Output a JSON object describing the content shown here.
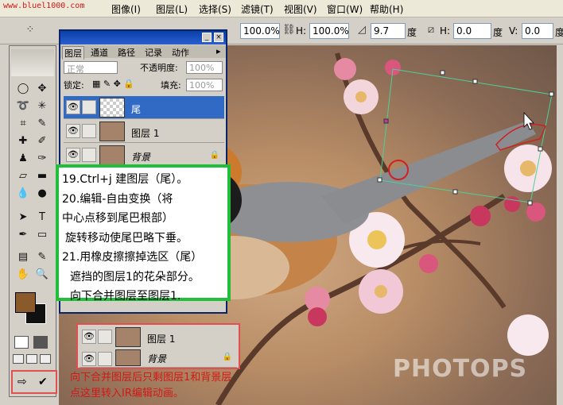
{
  "menubar": {
    "watermark": "www.bluel1000.com",
    "items": [
      "图像(I)",
      "图层(L)",
      "选择(S)",
      "滤镜(T)",
      "视图(V)",
      "窗口(W)",
      "帮助(H)"
    ]
  },
  "options": {
    "x_value": "100.0%",
    "h_label": "H:",
    "h_value": "100.0%",
    "angle_value": "9.7",
    "deg1": "度",
    "hskew_label": "H:",
    "hskew_value": "0.0",
    "deg2": "度",
    "vskew_label": "V:",
    "vskew_value": "0.0",
    "deg3": "度"
  },
  "layers_panel": {
    "tabs": [
      "图层",
      "通道",
      "路径",
      "记录",
      "动作"
    ],
    "blend_mode": "正常",
    "opacity_label": "不透明度:",
    "opacity_value": "100%",
    "lock_label": "锁定:",
    "fill_label": "填充:",
    "fill_value": "100%",
    "layers": [
      {
        "name": "尾",
        "selected": true
      },
      {
        "name": "图层 1",
        "selected": false
      },
      {
        "name": "背景",
        "selected": false
      }
    ]
  },
  "note": {
    "lines": [
      "19.Ctrl+j 建图层（尾）。",
      "20.编辑-自由变换（将",
      "中心点移到尾巴根部）",
      "旋转移动使尾巴略下垂。",
      "21.用橡皮擦擦掉选区（尾）",
      "遮挡的图层1的花朵部分。",
      "向下合并图层至图层1."
    ]
  },
  "merged_panel": {
    "layers": [
      "图层 1",
      "背景"
    ]
  },
  "bottom_note": {
    "line1": "向下合并图层后只剩图层1和背景层",
    "line2": "点这里转入IR编辑动画。"
  },
  "canvas": {
    "watermark": "PHOTOPS"
  },
  "colors": {
    "foreground": "#8a5a2a",
    "background": "#111111",
    "note_border": "#1fbf3a",
    "annotation_red": "#d21818"
  }
}
